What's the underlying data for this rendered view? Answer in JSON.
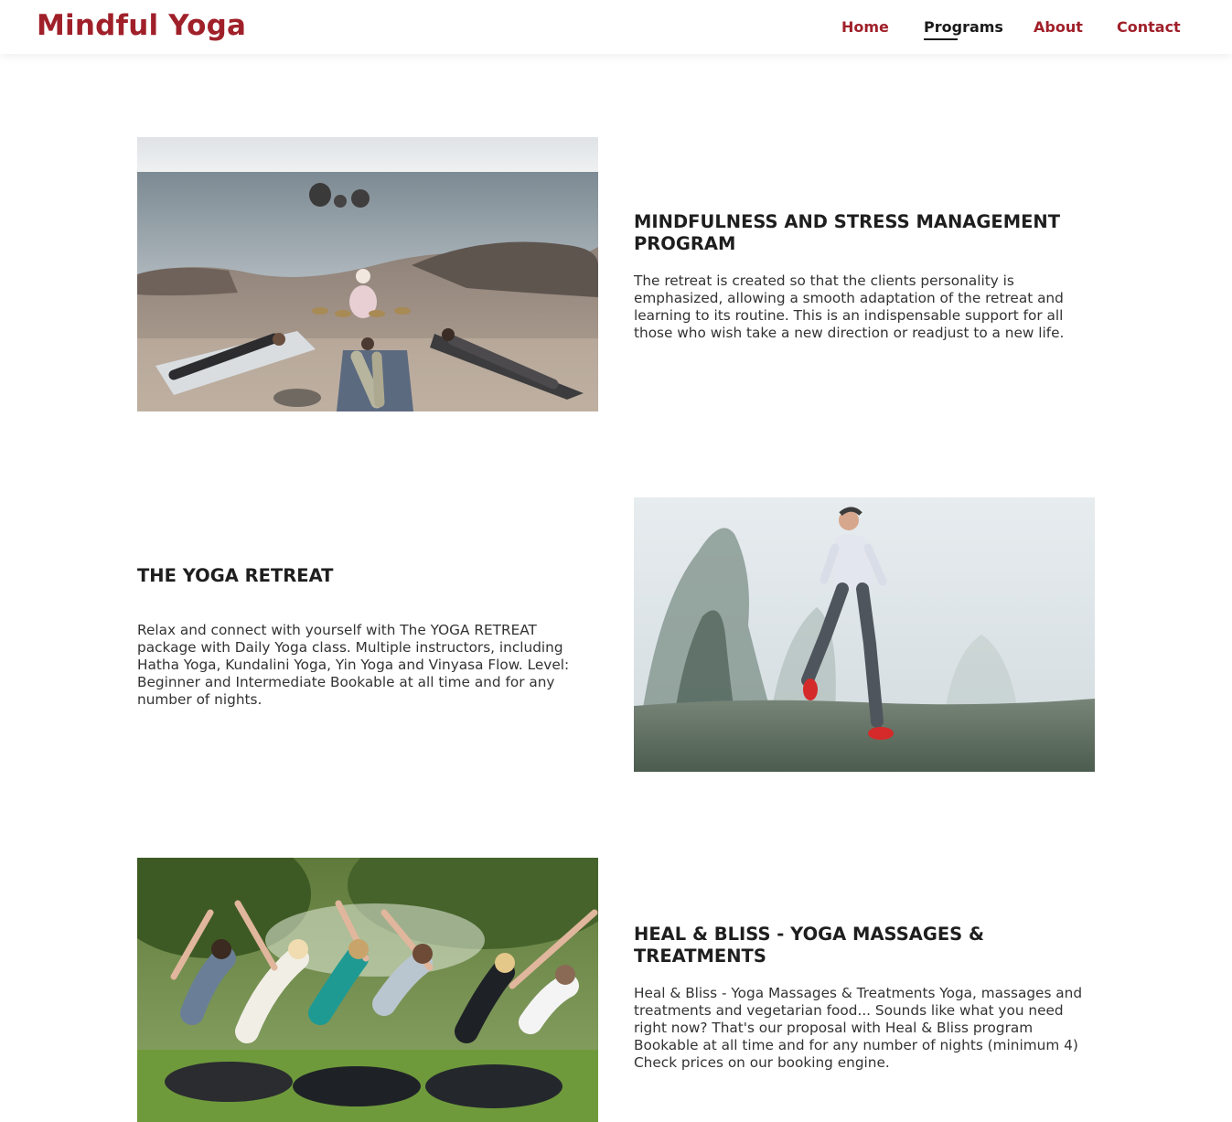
{
  "site": {
    "logo": "Mindful Yoga"
  },
  "nav": {
    "items": [
      {
        "label": "Home",
        "active": false
      },
      {
        "label": "Programs",
        "active": true
      },
      {
        "label": "About",
        "active": false
      },
      {
        "label": "Contact",
        "active": false
      }
    ]
  },
  "programs": [
    {
      "title": "MINDFULNESS AND STRESS MANAGEMENT PROGRAM",
      "description": "The retreat is created so that the clients personality is emphasized, allowing a smooth adaptation of the retreat and learning to its routine. This is an indispensable support for all those who wish take a new direction or readjust to a new life.",
      "image": "beach-meditation-photo"
    },
    {
      "title": "THE YOGA RETREAT",
      "description": "Relax and connect with yourself with The YOGA RETREAT package with Daily Yoga class. Multiple instructors, including Hatha Yoga, Kundalini Yoga, Yin Yoga and Vinyasa Flow. Level: Beginner and Intermediate Bookable at all time and for any number of nights.",
      "image": "foggy-runner-photo"
    },
    {
      "title": "HEAL & BLISS - YOGA MASSAGES & TREATMENTS",
      "description": "Heal & Bliss - Yoga Massages & Treatments Yoga, massages and treatments and vegetarian food... Sounds like what you need right now? That's our proposal with Heal & Bliss program Bookable at all time and for any number of nights (minimum 4) Check prices on our booking engine.",
      "image": "park-yoga-group-photo"
    }
  ],
  "colors": {
    "brand": "#a0202a",
    "active_nav": "#1a1a1a",
    "heading": "#1e1e1e",
    "body_text": "#333333"
  }
}
